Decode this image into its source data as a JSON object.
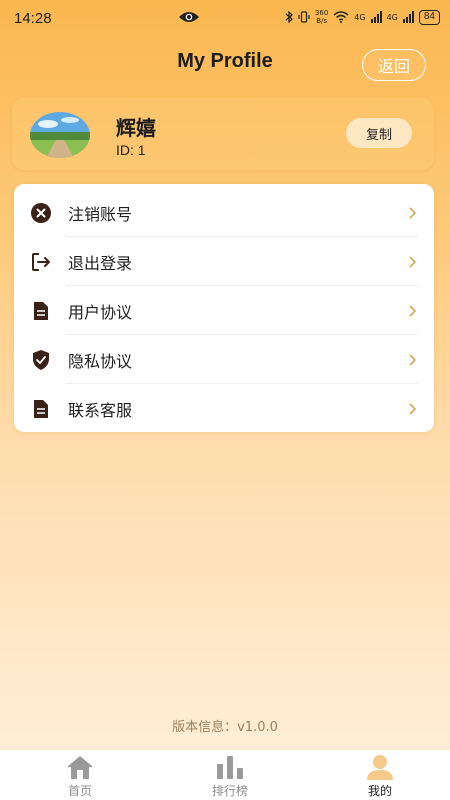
{
  "status_bar": {
    "time": "14:28",
    "net_speed_top": "360",
    "net_speed_bottom": "B/s",
    "net1": "4G",
    "net2": "4G",
    "battery": "84"
  },
  "header": {
    "title": "My Profile",
    "back_label": "返回"
  },
  "profile": {
    "name": "辉嬉",
    "id_text": "ID: 1",
    "copy_label": "复制"
  },
  "menu": {
    "items": [
      {
        "label": "注销账号",
        "icon": "close-circle-icon"
      },
      {
        "label": "退出登录",
        "icon": "logout-icon"
      },
      {
        "label": "用户协议",
        "icon": "document-icon"
      },
      {
        "label": "隐私协议",
        "icon": "shield-check-icon"
      },
      {
        "label": "联系客服",
        "icon": "document-icon"
      }
    ]
  },
  "version": "版本信息：v1.0.0",
  "bottom_nav": {
    "items": [
      {
        "label": "首页",
        "icon": "home-icon",
        "active": false
      },
      {
        "label": "排行榜",
        "icon": "bar-chart-icon",
        "active": false
      },
      {
        "label": "我的",
        "icon": "person-icon",
        "active": true
      }
    ]
  },
  "colors": {
    "icon_brown": "#3b2218",
    "chevron": "#d9a552",
    "accent_gradient_top": "#fbb74f",
    "nav_active_icon": "#f5c98a",
    "nav_inactive_icon": "#9a9a9a"
  }
}
